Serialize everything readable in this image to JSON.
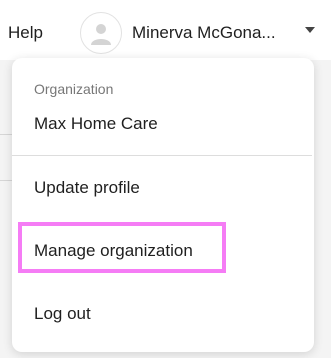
{
  "header": {
    "help_label": "Help",
    "user_name": "Minerva McGona...",
    "avatar_icon": "user-avatar-icon",
    "dropdown_icon": "chevron-down-icon"
  },
  "dropdown": {
    "section_label": "Organization",
    "organization_name": "Max Home Care",
    "items": [
      {
        "label": "Update profile"
      },
      {
        "label": "Manage organization"
      },
      {
        "label": "Log out"
      }
    ]
  },
  "colors": {
    "highlight_border": "#f57cf5",
    "text": "#1f1f1f",
    "muted_text": "#777777"
  }
}
